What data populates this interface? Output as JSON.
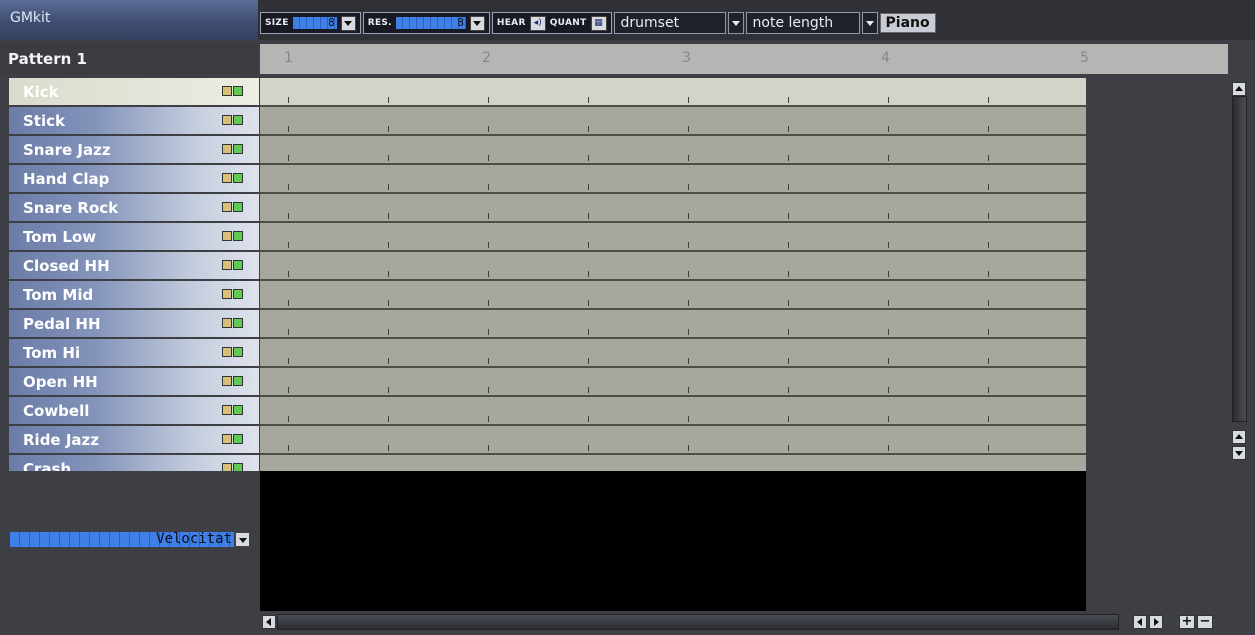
{
  "drumkit": {
    "name": "GMkit"
  },
  "toolbar": {
    "size_label": "SIZE",
    "size_value": "8",
    "res_label": "RES.",
    "res_value": "8",
    "hear_label": "HEAR",
    "quant_label": "QUANT",
    "instrument_combo": "drumset",
    "view_combo": "note length",
    "piano_label": "Piano"
  },
  "pattern": {
    "name": "Pattern 1"
  },
  "ruler": {
    "beats": [
      "1",
      "2",
      "3",
      "4",
      "5"
    ]
  },
  "instruments": [
    {
      "name": "Kick",
      "selected": true
    },
    {
      "name": "Stick",
      "selected": false
    },
    {
      "name": "Snare Jazz",
      "selected": false
    },
    {
      "name": "Hand Clap",
      "selected": false
    },
    {
      "name": "Snare Rock",
      "selected": false
    },
    {
      "name": "Tom Low",
      "selected": false
    },
    {
      "name": "Closed HH",
      "selected": false
    },
    {
      "name": "Tom Mid",
      "selected": false
    },
    {
      "name": "Pedal HH",
      "selected": false
    },
    {
      "name": "Tom Hi",
      "selected": false
    },
    {
      "name": "Open HH",
      "selected": false
    },
    {
      "name": "Cowbell",
      "selected": false
    },
    {
      "name": "Ride Jazz",
      "selected": false
    },
    {
      "name": "Crash",
      "selected": false
    }
  ],
  "velocity": {
    "label": "Velocitat"
  },
  "colors": {
    "accent_blue": "#3f7fe6",
    "grid_row": "#a7a79d",
    "selected_row": "#d3d4c9",
    "mute_led": "#d8c07a",
    "solo_led": "#5fcc4f"
  },
  "icons": {
    "hear": "speaker-icon",
    "quant": "grid-icon",
    "dropdown": "chevron-down-icon"
  }
}
